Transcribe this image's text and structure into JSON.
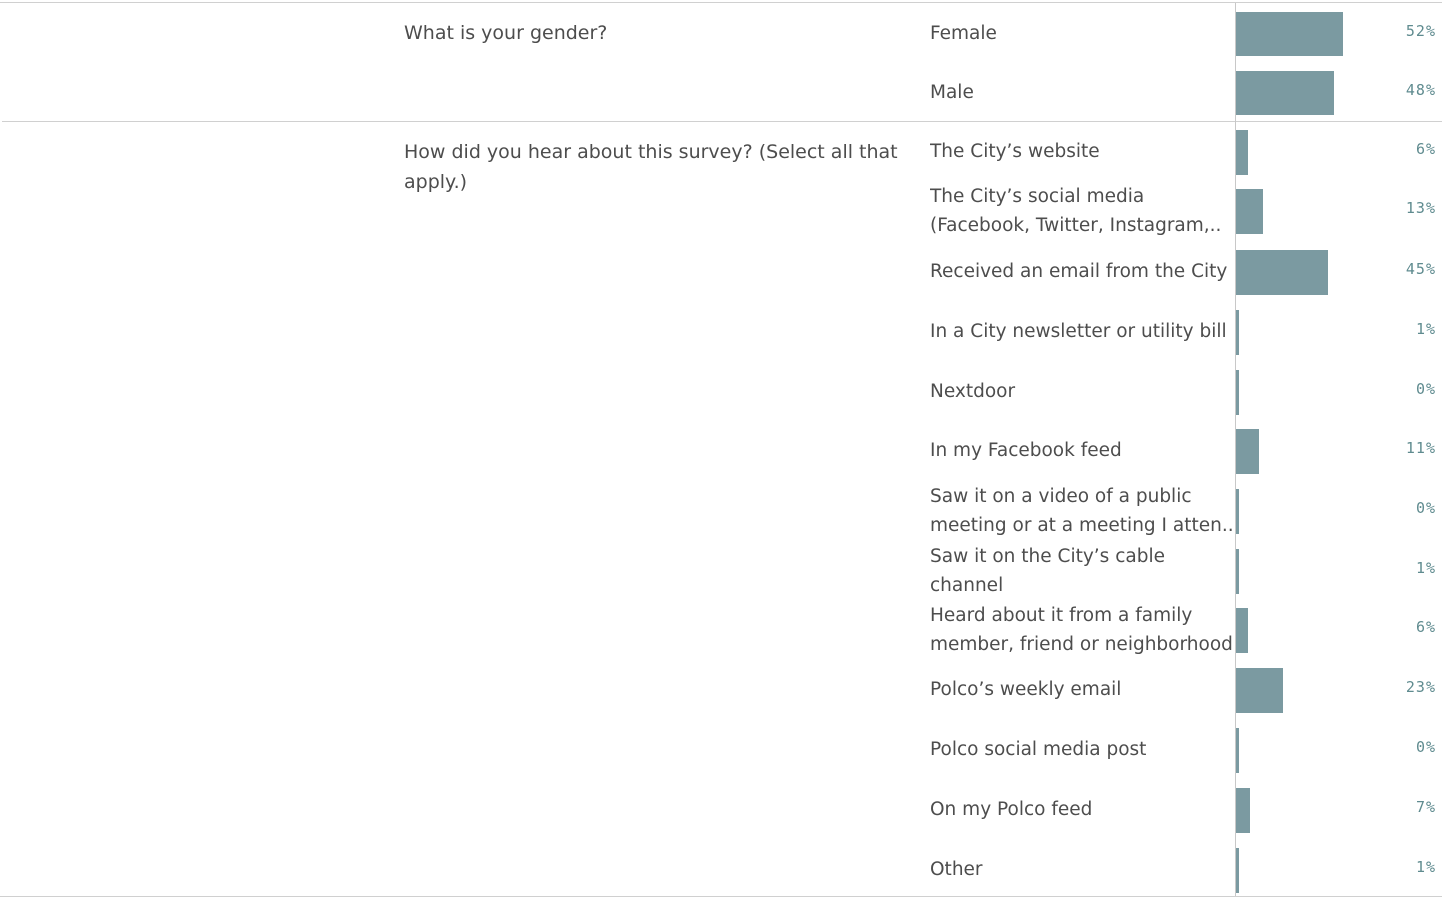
{
  "chart_data": {
    "type": "bar",
    "orientation": "horizontal",
    "questions": [
      {
        "question": "What is your gender?",
        "answers": [
          {
            "label": "Female",
            "value": 52,
            "pct_label": "52%"
          },
          {
            "label": "Male",
            "value": 48,
            "pct_label": "48%"
          }
        ]
      },
      {
        "question": "How did you hear about this survey? (Select all that apply.)",
        "answers": [
          {
            "label": "The City’s website",
            "value": 6,
            "pct_label": "6%"
          },
          {
            "label": "The City’s social media (Facebook, Twitter, Instagram,..",
            "value": 13,
            "pct_label": "13%"
          },
          {
            "label": "Received an email from the City",
            "value": 45,
            "pct_label": "45%"
          },
          {
            "label": "In a City newsletter or utility bill",
            "value": 1,
            "pct_label": "1%"
          },
          {
            "label": "Nextdoor",
            "value": 0,
            "pct_label": "0%"
          },
          {
            "label": "In my Facebook feed",
            "value": 11,
            "pct_label": "11%"
          },
          {
            "label": "Saw it on a video of a public meeting or at a meeting I atten..",
            "value": 0,
            "pct_label": "0%"
          },
          {
            "label": "Saw it on the City’s cable channel",
            "value": 1,
            "pct_label": "1%"
          },
          {
            "label": "Heard about it from a family member, friend or neighborhood",
            "value": 6,
            "pct_label": "6%"
          },
          {
            "label": "Polco’s weekly email",
            "value": 23,
            "pct_label": "23%"
          },
          {
            "label": "Polco social media post",
            "value": 0,
            "pct_label": "0%"
          },
          {
            "label": "On my Polco feed",
            "value": 7,
            "pct_label": "7%"
          },
          {
            "label": "Other",
            "value": 1,
            "pct_label": "1%"
          }
        ]
      }
    ],
    "xlim": [
      0,
      100
    ],
    "bar_color": "#7b9aa1",
    "label_color": "#5f8b8f"
  }
}
